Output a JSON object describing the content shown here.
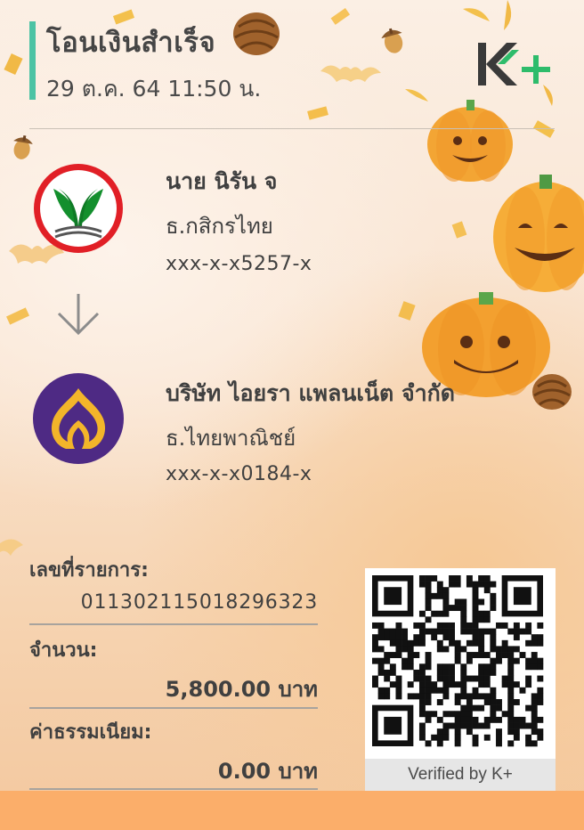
{
  "header": {
    "title": "โอนเงินสำเร็จ",
    "datetime": "29 ต.ค. 64  11:50 น.",
    "brand": "K+",
    "accent_color": "#4cc3a4"
  },
  "sender": {
    "name": "นาย นิรัน จ",
    "bank": "ธ.กสิกรไทย",
    "account": "xxx-x-x5257-x",
    "logo_icon": "kasikorn-bank-logo"
  },
  "transfer_icon": "arrow-down-icon",
  "receiver": {
    "name": "บริษัท ไอยรา แพลนเน็ต จำกัด",
    "bank": "ธ.ไทยพาณิชย์",
    "account": "xxx-x-x0184-x",
    "logo_icon": "scb-bank-logo"
  },
  "details": {
    "ref_label": "เลขที่รายการ:",
    "ref_value": "011302115018296323",
    "amount_label": "จำนวน:",
    "amount_value": "5,800.00 บาท",
    "fee_label": "ค่าธรรมเนียม:",
    "fee_value": "0.00 บาท"
  },
  "qr": {
    "caption": "Verified by K+"
  },
  "colors": {
    "kbank_green": "#138f2d",
    "kbank_red": "#e11f26",
    "scb_purple": "#4e2a84",
    "scb_gold": "#f3b52a",
    "footer_orange": "#fbae6a"
  }
}
